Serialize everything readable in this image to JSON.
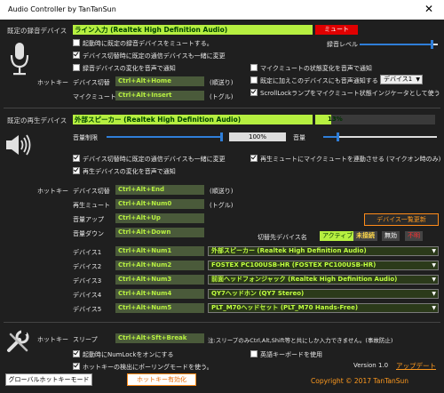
{
  "window": {
    "title": "Audio Controller by TanTanSun",
    "close": "✕"
  },
  "record": {
    "section_title": "既定の録音デバイス",
    "device": "ライン入力 (Realtek High Definition Audio)",
    "mute_status": "ミュート",
    "level_label": "録音レベル",
    "level": 0.93,
    "options": [
      {
        "label": "起動時に既定の録音デバイスをミュートする。",
        "checked": false
      },
      {
        "label": "デバイス切替時に既定の通信デバイスも一緒に変更",
        "checked": true
      },
      {
        "label": "録音デバイスの変化を音声で通知",
        "checked": false
      },
      {
        "label": "マイクミュートの状態変化を音声で通知",
        "checked": false
      },
      {
        "label": "既定に加えこのデバイスにも音声通知する",
        "checked": false
      },
      {
        "label": "ScrollLockランプをマイクミュート状態インジケータとして使う",
        "checked": true
      }
    ],
    "notify_device": "デバイス1",
    "hotkey_label": "ホットキー",
    "hotkeys": [
      {
        "label": "デバイス切替",
        "key": "Ctrl+Alt+Home",
        "note": "(順送り)"
      },
      {
        "label": "マイクミュート",
        "key": "Ctrl+Alt+Insert",
        "note": "(トグル)"
      }
    ]
  },
  "playback": {
    "section_title": "既定の再生デバイス",
    "device": "外部スピーカー (Realtek High Definition Audio)",
    "volume_readout": "13%",
    "limit_label": "音量制限",
    "limit_value": "100%",
    "limit_level": 1.0,
    "volume_label": "音量",
    "volume_level": 0.13,
    "options": [
      {
        "label": "デバイス切替時に既定の通信デバイスも一緒に変更",
        "checked": true
      },
      {
        "label": "再生ミュートにマイクミュートを連動させる (マイクオン時のみ)",
        "checked": true
      },
      {
        "label": "再生デバイスの変化を音声で通知",
        "checked": true
      }
    ],
    "hotkey_label": "ホットキー",
    "hotkeys": [
      {
        "label": "デバイス切替",
        "key": "Ctrl+Alt+End",
        "note": "(順送り)"
      },
      {
        "label": "再生ミュート",
        "key": "Ctrl+Alt+Num0",
        "note": "(トグル)"
      },
      {
        "label": "音量アップ",
        "key": "Ctrl+Alt+Up",
        "note": ""
      },
      {
        "label": "音量ダウン",
        "key": "Ctrl+Alt+Down",
        "note": ""
      }
    ],
    "device_list_button": "デバイス一覧更新",
    "switch_target_label": "切替先デバイス名",
    "legend": {
      "active": "アクティブ",
      "unconnected": "未接続",
      "disabled": "無効",
      "missing": "不明"
    },
    "devices": [
      {
        "label": "デバイス1",
        "key": "Ctrl+Alt+Num1",
        "device": "外部スピーカー (Realtek High Definition Audio)"
      },
      {
        "label": "デバイス2",
        "key": "Ctrl+Alt+Num2",
        "device": "FOSTEX PC100USB-HR (FOSTEX PC100USB-HR)"
      },
      {
        "label": "デバイス3",
        "key": "Ctrl+Alt+Num3",
        "device": "前面ヘッドフォンジャック (Realtek High Definition Audio)"
      },
      {
        "label": "デバイス4",
        "key": "Ctrl+Alt+Num4",
        "device": "QY7ヘッドホン (QY7 Stereo)"
      },
      {
        "label": "デバイス5",
        "key": "Ctrl+Alt+Num5",
        "device": "PLT_M70ヘッドセット (PLT_M70 Hands-Free)"
      }
    ]
  },
  "global": {
    "hotkey_label": "ホットキー",
    "sleep_label": "スリープ",
    "sleep_key": "Ctrl+Alt+Sft+Break",
    "sleep_note": "注:スリープのみCtrl,Alt,Shift等と共にしか入力できません。(事故防止)",
    "options": [
      {
        "label": "起動時にNumLockをオンにする",
        "checked": true
      },
      {
        "label": "英語キーボードを使用",
        "checked": false
      },
      {
        "label": "ホットキーの検出にポーリングモードを使う。",
        "checked": true
      }
    ],
    "version": "Version 1.0",
    "update_link": "アップデート",
    "global_hotkey_mode": "グローバルホットキーモード",
    "hotkey_enabled": "ホットキー有効化",
    "copyright": "Copyright © 2017 TanTanSun"
  }
}
